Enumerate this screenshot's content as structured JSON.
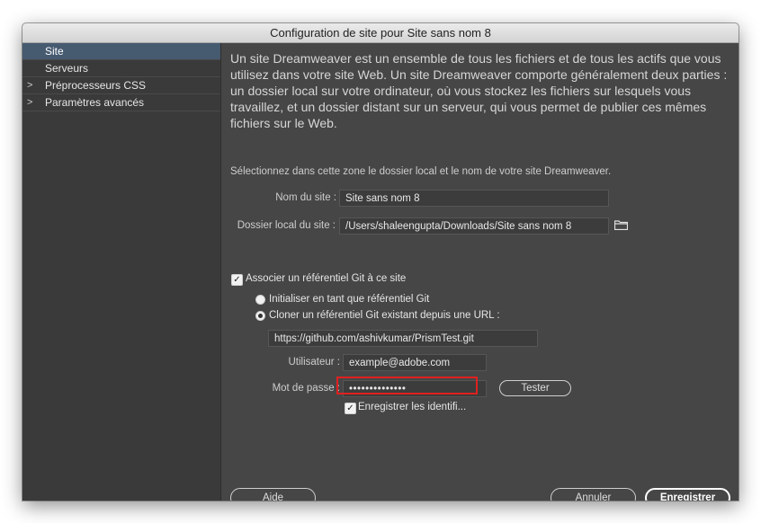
{
  "window": {
    "title": "Configuration de site pour Site sans nom 8"
  },
  "sidebar": {
    "items": [
      {
        "label": "Site",
        "selected": true,
        "expandable": false
      },
      {
        "label": "Serveurs",
        "selected": false,
        "expandable": false
      },
      {
        "label": "Préprocesseurs CSS",
        "selected": false,
        "expandable": true
      },
      {
        "label": "Paramètres avancés",
        "selected": false,
        "expandable": true
      }
    ]
  },
  "site": {
    "intro": "Un site Dreamweaver est un ensemble de tous les fichiers et de tous les actifs que vous utilisez dans votre site Web. Un site Dreamweaver comporte généralement deux parties : un dossier local sur votre ordinateur, où vous stockez les fichiers sur lesquels vous travaillez, et un dossier distant sur un serveur, qui vous permet de publier ces mêmes fichiers sur le Web.",
    "hint": "Sélectionnez dans cette zone le dossier local et le nom de votre site Dreamweaver.",
    "site_name_label": "Nom du site :",
    "site_name_value": "Site sans nom 8",
    "local_folder_label": "Dossier local du site :",
    "local_folder_value": "/Users/shaleengupta/Downloads/Site sans nom 8",
    "folder_icon": "folder-icon"
  },
  "git": {
    "associate_label": "Associer un référentiel Git à ce site",
    "associate_checked": true,
    "init_label": "Initialiser en tant que référentiel Git",
    "init_selected": false,
    "clone_label": "Cloner un référentiel Git existant depuis une URL :",
    "clone_selected": true,
    "url_value": "https://github.com/ashivkumar/PrismTest.git",
    "user_label": "Utilisateur :",
    "user_value": "example@adobe.com",
    "password_label": "Mot de passe :",
    "password_value": "••••••••••••••",
    "test_button": "Tester",
    "save_credentials_label": "Enregistrer les identifi...",
    "save_credentials_checked": true
  },
  "footer": {
    "help_button": "Aide",
    "cancel_button": "Annuler",
    "save_button": "Enregistrer"
  },
  "colors": {
    "panel_bg": "#464646",
    "sidebar_bg": "#3a3a3a",
    "selection": "#465a70",
    "highlight_border": "#e02020"
  }
}
